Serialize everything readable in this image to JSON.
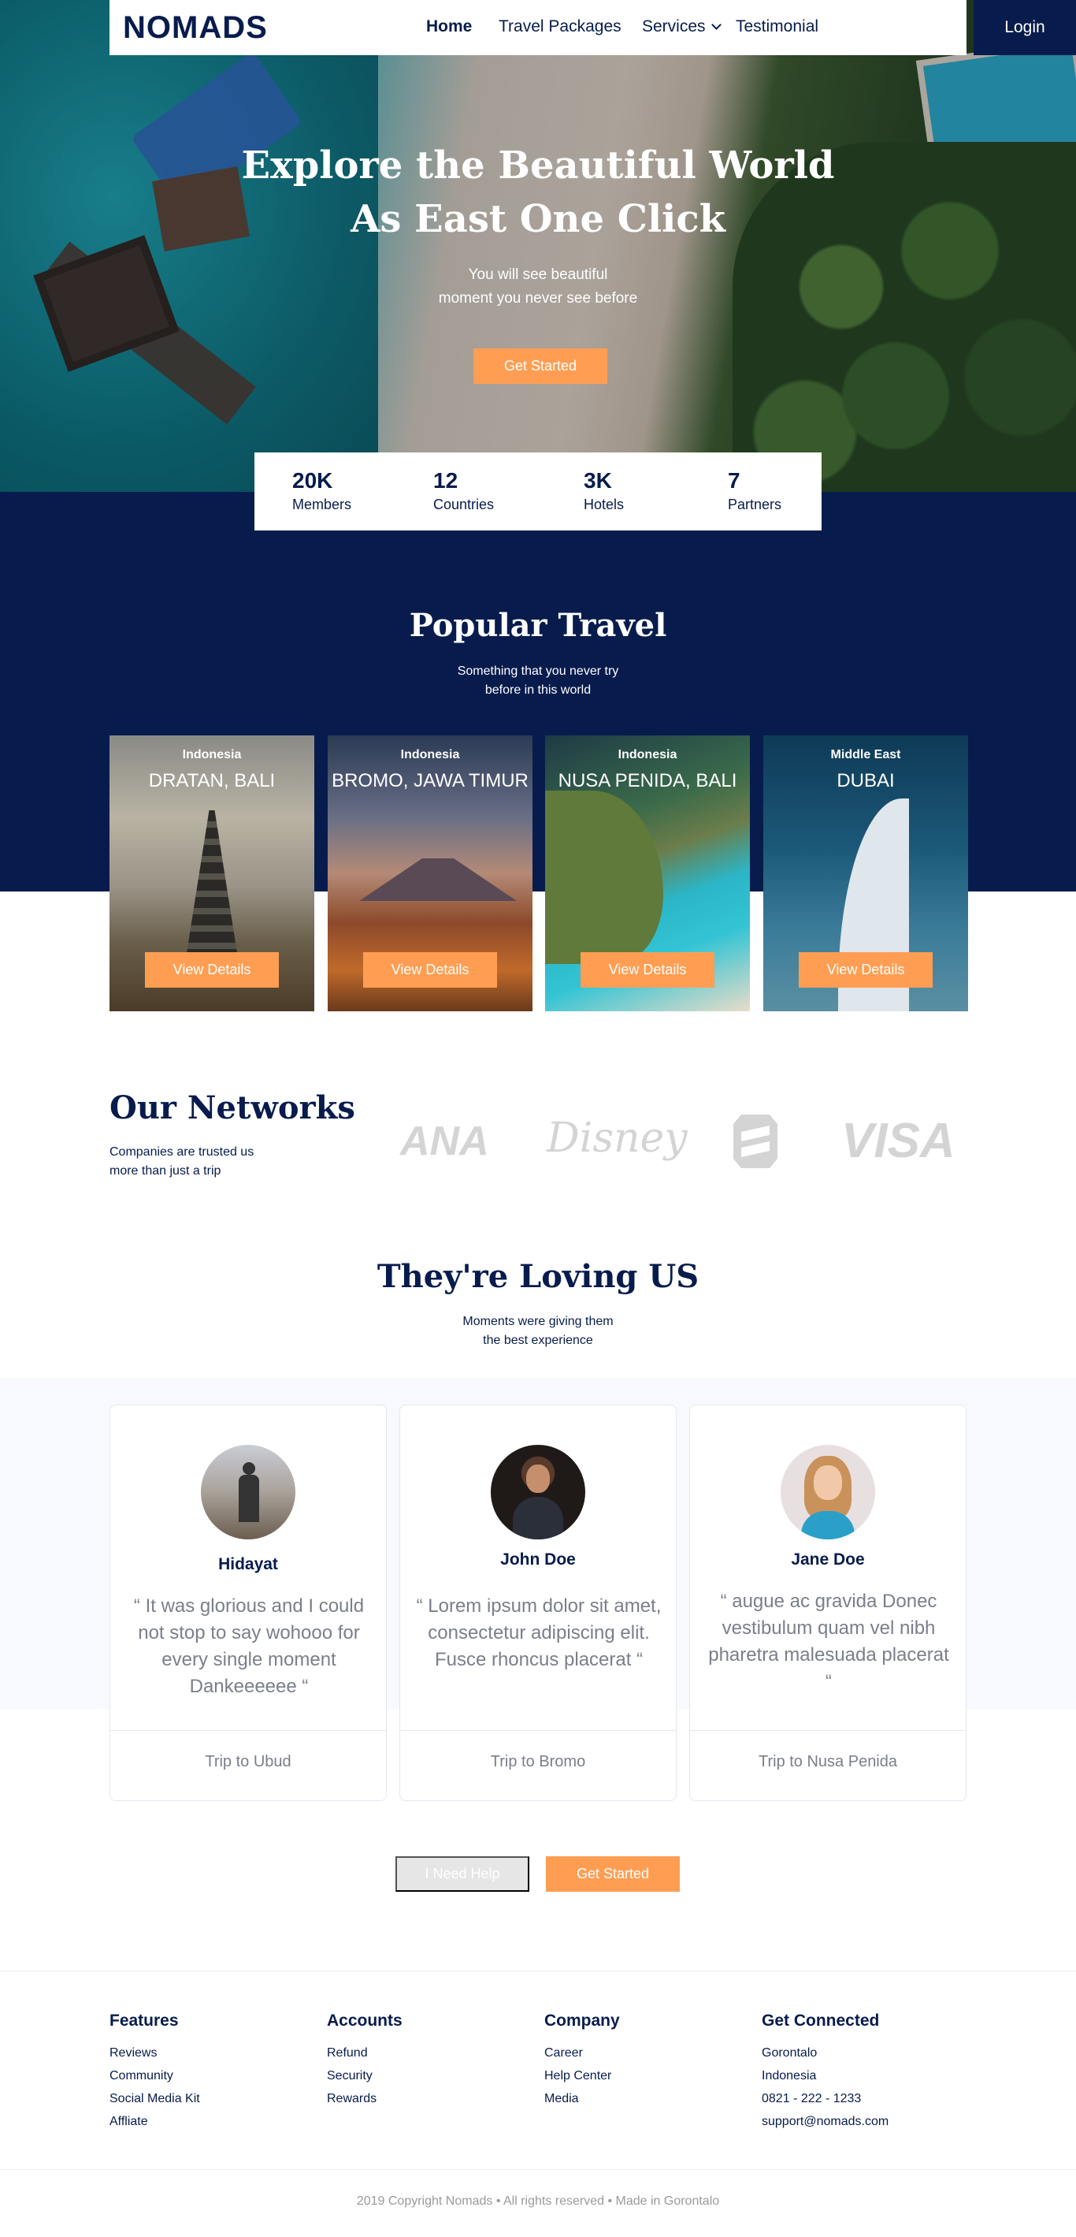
{
  "nav": {
    "logo": "NOMADS",
    "items": [
      {
        "label": "Home"
      },
      {
        "label": "Travel Packages"
      },
      {
        "label": "Services"
      },
      {
        "label": "Testimonial"
      }
    ],
    "login": "Login"
  },
  "hero": {
    "title_line1": "Explore the Beautiful World",
    "title_line2": "As East One Click",
    "subtitle_line1": "You will see beautiful",
    "subtitle_line2": "moment you never see before",
    "cta": "Get Started"
  },
  "stats": [
    {
      "value": "20K",
      "label": "Members"
    },
    {
      "value": "12",
      "label": "Countries"
    },
    {
      "value": "3K",
      "label": "Hotels"
    },
    {
      "value": "7",
      "label": "Partners"
    }
  ],
  "popular": {
    "title": "Popular Travel",
    "subtitle_line1": "Something that you never try",
    "subtitle_line2": "before in this world",
    "cards": [
      {
        "country": "Indonesia",
        "place": "DRATAN, BALI",
        "button": "View Details"
      },
      {
        "country": "Indonesia",
        "place": "BROMO, JAWA TIMUR",
        "button": "View Details"
      },
      {
        "country": "Indonesia",
        "place": "NUSA PENIDA, BALI",
        "button": "View Details"
      },
      {
        "country": "Middle East",
        "place": "DUBAI",
        "button": "View Details"
      }
    ]
  },
  "networks": {
    "title": "Our Networks",
    "subtitle_line1": "Companies are trusted us",
    "subtitle_line2": "more than just a trip",
    "brands": [
      "ANA",
      "Disney",
      "VISA"
    ]
  },
  "testimonials": {
    "title": "They're Loving US",
    "subtitle_line1": "Moments were giving them",
    "subtitle_line2": "the best experience",
    "items": [
      {
        "name": "Hidayat",
        "quote": "“ It was glorious and I could not stop to say wohooo for every single moment Dankeeeeee “",
        "trip": "Trip to Ubud"
      },
      {
        "name": "John Doe",
        "quote": "“ Lorem ipsum dolor sit amet, consectetur adipiscing elit. Fusce rhoncus placerat “",
        "trip": "Trip to Bromo"
      },
      {
        "name": "Jane Doe",
        "quote": "“ augue ac gravida Donec vestibulum quam vel nibh pharetra malesuada placerat “",
        "trip": "Trip to Nusa Penida"
      }
    ],
    "help_button": "I Need Help",
    "start_button": "Get Started"
  },
  "footer": {
    "columns": [
      {
        "title": "Features",
        "links": [
          "Reviews",
          "Community",
          "Social Media Kit",
          "Affliate"
        ]
      },
      {
        "title": "Accounts",
        "links": [
          "Refund",
          "Security",
          "Rewards"
        ]
      },
      {
        "title": "Company",
        "links": [
          "Career",
          "Help Center",
          "Media"
        ]
      },
      {
        "title": "Get Connected",
        "links": [
          "Gorontalo",
          "Indonesia",
          "0821 - 222 - 1233",
          "support@nomads.com"
        ]
      }
    ],
    "copyright": "2019 Copyright Nomads • All rights reserved • Made in Gorontalo"
  },
  "colors": {
    "navy": "#071C4D",
    "orange": "#FF9E53",
    "light_bg": "#F8F9FE"
  }
}
